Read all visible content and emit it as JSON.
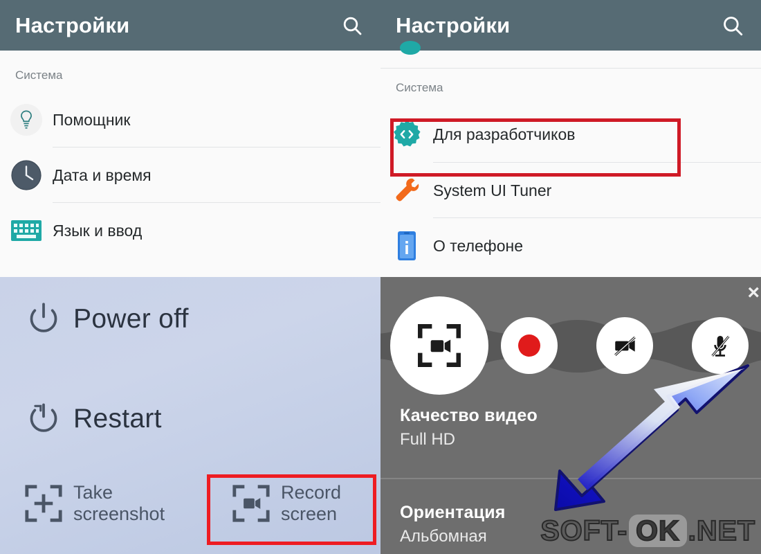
{
  "settings_left": {
    "app_title": "Настройки",
    "search_icon": "search-icon",
    "section_label": "Система",
    "items": [
      {
        "label": "Помощник",
        "icon": "lightbulb-icon"
      },
      {
        "label": "Дата и время",
        "icon": "clock-icon"
      },
      {
        "label": "Язык и ввод",
        "icon": "keyboard-icon"
      }
    ]
  },
  "settings_right": {
    "app_title": "Настройки",
    "search_icon": "search-icon",
    "section_label": "Система",
    "items": [
      {
        "label": "Для разработчиков",
        "icon": "developer-options-icon",
        "highlighted": true
      },
      {
        "label": "System UI Tuner",
        "icon": "wrench-icon",
        "highlighted": false
      },
      {
        "label": "О телефоне",
        "icon": "phone-info-icon",
        "highlighted": false
      }
    ],
    "highlight_color": "#cf1a26"
  },
  "power_menu": {
    "items": [
      {
        "label": "Power off",
        "icon": "power-icon"
      },
      {
        "label": "Restart",
        "icon": "restart-icon"
      }
    ],
    "capture_items": [
      {
        "line1": "Take",
        "line2": "screenshot",
        "icon": "take-screenshot-icon",
        "highlighted": false
      },
      {
        "line1": "Record",
        "line2": "screen",
        "icon": "record-screen-icon",
        "highlighted": true
      }
    ],
    "highlight_color": "#ee1c22"
  },
  "recorder": {
    "close_label": "×",
    "buttons": [
      {
        "name": "record-screen-main-button",
        "icon": "screen-record-frame-icon"
      },
      {
        "name": "start-record-button",
        "icon": "record-dot-icon",
        "color": "#e01b1b"
      },
      {
        "name": "camera-off-button",
        "icon": "camera-off-icon"
      },
      {
        "name": "mic-off-button",
        "icon": "mic-off-icon"
      },
      {
        "name": "settings-button",
        "icon": "gear-icon"
      }
    ],
    "settings": [
      {
        "title": "Качество видео",
        "value": "Full HD"
      },
      {
        "title": "Ориентация",
        "value": "Альбомная"
      }
    ],
    "pointer_icon": "blue-arrow-pointer"
  },
  "watermark": {
    "pre": "SOFT-",
    "box": "OK",
    "post": ".NET"
  }
}
